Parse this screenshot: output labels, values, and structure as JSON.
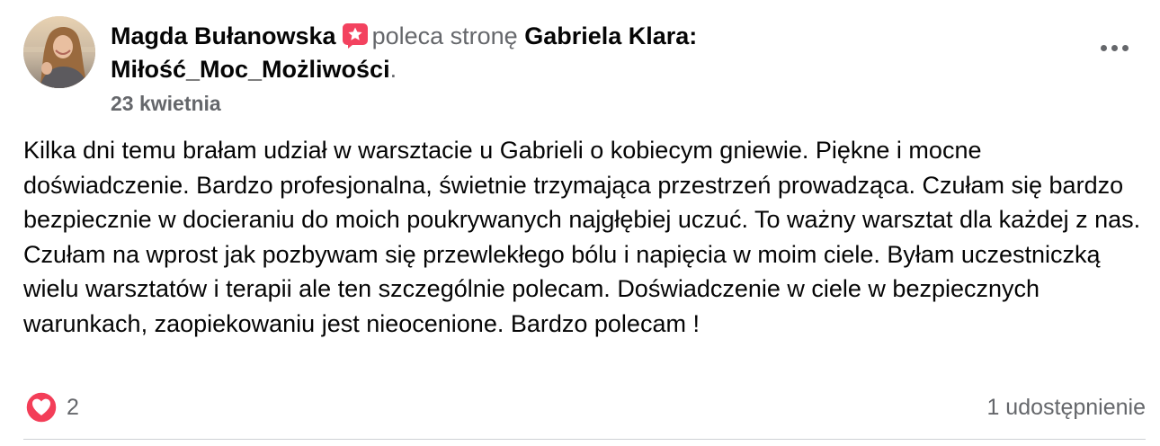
{
  "post": {
    "author_name": "Magda Bułanowska",
    "recommend_verb": "poleca stronę",
    "page_name_line1": "Gabriela Klara:",
    "page_name_line2": "Miłość_Moc_Możliwości",
    "period": ".",
    "date": "23 kwietnia",
    "body": "Kilka dni temu brałam udział w warsztacie u Gabrieli o kobiecym gniewie. Piękne i mocne doświadczenie. Bardzo profesjonalna, świetnie trzymająca przestrzeń prowadząca. Czułam się bardzo bezpiecznie w docieraniu do moich poukrywanych najgłębiej uczuć. To ważny warsztat dla każdej z nas. Czułam na wprost jak pozbywam się przewlekłego bólu i napięcia w moim ciele. Byłam uczestniczką wielu warsztatów i terapii ale ten szczególnie polecam. Doświadczenie w ciele w bezpiecznych warunkach, zaopiekowaniu jest nieocenione. Bardzo polecam !",
    "reaction_count": "2",
    "share_text": "1 udostępnienie"
  },
  "icons": {
    "recommend_badge": "star-badge-icon",
    "reaction": "heart-icon",
    "more": "more-options-icon"
  },
  "colors": {
    "text_primary": "#050505",
    "text_secondary": "#65676b",
    "badge_pink": "#f3425f",
    "reaction_red": "#f33e58",
    "divider": "#ced0d4"
  }
}
